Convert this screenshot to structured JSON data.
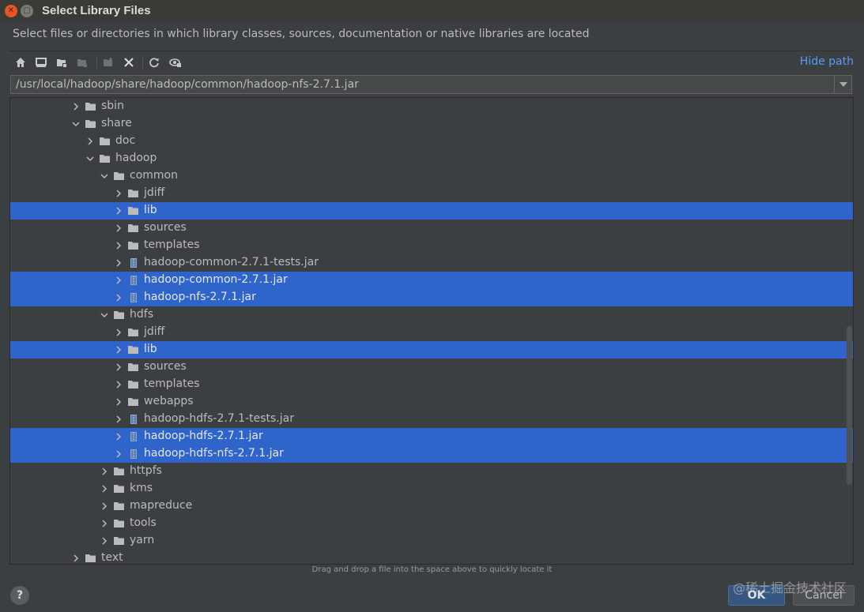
{
  "window": {
    "title": "Select Library Files",
    "description": "Select files or directories in which library classes, sources, documentation or native libraries are located"
  },
  "toolbar": {
    "buttons": [
      "home-icon",
      "desktop-icon",
      "project-folder-icon",
      "module-folder-icon",
      "new-folder-icon",
      "delete-icon",
      "refresh-icon",
      "show-hidden-icon"
    ],
    "hide_path_label": "Hide path"
  },
  "path": {
    "value": "/usr/local/hadoop/share/hadoop/common/hadoop-nfs-2.7.1.jar"
  },
  "tree": {
    "rows": [
      {
        "label": "sbin",
        "type": "folder",
        "depth": 0,
        "expanded": false,
        "selected": false
      },
      {
        "label": "share",
        "type": "folder",
        "depth": 0,
        "expanded": true,
        "selected": false
      },
      {
        "label": "doc",
        "type": "folder",
        "depth": 1,
        "expanded": false,
        "selected": false
      },
      {
        "label": "hadoop",
        "type": "folder",
        "depth": 1,
        "expanded": true,
        "selected": false
      },
      {
        "label": "common",
        "type": "folder",
        "depth": 2,
        "expanded": true,
        "selected": false
      },
      {
        "label": "jdiff",
        "type": "folder",
        "depth": 3,
        "expanded": false,
        "selected": false
      },
      {
        "label": "lib",
        "type": "folder",
        "depth": 3,
        "expanded": false,
        "selected": true
      },
      {
        "label": "sources",
        "type": "folder",
        "depth": 3,
        "expanded": false,
        "selected": false
      },
      {
        "label": "templates",
        "type": "folder",
        "depth": 3,
        "expanded": false,
        "selected": false
      },
      {
        "label": "hadoop-common-2.7.1-tests.jar",
        "type": "jar",
        "depth": 3,
        "expanded": false,
        "selected": false
      },
      {
        "label": "hadoop-common-2.7.1.jar",
        "type": "jar",
        "depth": 3,
        "expanded": false,
        "selected": true
      },
      {
        "label": "hadoop-nfs-2.7.1.jar",
        "type": "jar",
        "depth": 3,
        "expanded": false,
        "selected": true
      },
      {
        "label": "hdfs",
        "type": "folder",
        "depth": 2,
        "expanded": true,
        "selected": false
      },
      {
        "label": "jdiff",
        "type": "folder",
        "depth": 3,
        "expanded": false,
        "selected": false
      },
      {
        "label": "lib",
        "type": "folder",
        "depth": 3,
        "expanded": false,
        "selected": true
      },
      {
        "label": "sources",
        "type": "folder",
        "depth": 3,
        "expanded": false,
        "selected": false
      },
      {
        "label": "templates",
        "type": "folder",
        "depth": 3,
        "expanded": false,
        "selected": false
      },
      {
        "label": "webapps",
        "type": "folder",
        "depth": 3,
        "expanded": false,
        "selected": false
      },
      {
        "label": "hadoop-hdfs-2.7.1-tests.jar",
        "type": "jar",
        "depth": 3,
        "expanded": false,
        "selected": false
      },
      {
        "label": "hadoop-hdfs-2.7.1.jar",
        "type": "jar",
        "depth": 3,
        "expanded": false,
        "selected": true
      },
      {
        "label": "hadoop-hdfs-nfs-2.7.1.jar",
        "type": "jar",
        "depth": 3,
        "expanded": false,
        "selected": true
      },
      {
        "label": "httpfs",
        "type": "folder",
        "depth": 2,
        "expanded": false,
        "selected": false
      },
      {
        "label": "kms",
        "type": "folder",
        "depth": 2,
        "expanded": false,
        "selected": false
      },
      {
        "label": "mapreduce",
        "type": "folder",
        "depth": 2,
        "expanded": false,
        "selected": false
      },
      {
        "label": "tools",
        "type": "folder",
        "depth": 2,
        "expanded": false,
        "selected": false
      },
      {
        "label": "yarn",
        "type": "folder",
        "depth": 2,
        "expanded": false,
        "selected": false
      },
      {
        "label": "text",
        "type": "folder",
        "depth": 0,
        "expanded": false,
        "selected": false
      }
    ]
  },
  "hint": "Drag and drop a file into the space above to quickly locate it",
  "footer": {
    "help_label": "?",
    "ok_label": "OK",
    "cancel_label": "Cancel",
    "watermark": "@稀土掘金技术社区"
  },
  "colors": {
    "background": "#3c3f41",
    "selection": "#2f65ca",
    "link": "#589df6"
  }
}
